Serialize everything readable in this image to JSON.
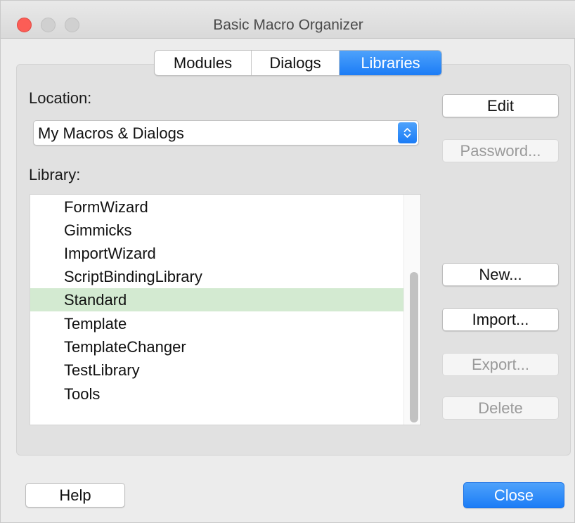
{
  "window": {
    "title": "Basic Macro Organizer"
  },
  "tabs": [
    {
      "label": "Modules"
    },
    {
      "label": "Dialogs"
    },
    {
      "label": "Libraries",
      "active": true
    }
  ],
  "location": {
    "label": "Location:",
    "selected": "My Macros & Dialogs"
  },
  "library": {
    "label": "Library:",
    "items": [
      "FormWizard",
      "Gimmicks",
      "ImportWizard",
      "ScriptBindingLibrary",
      "Standard",
      "Template",
      "TemplateChanger",
      "TestLibrary",
      "Tools"
    ],
    "selected": "Standard"
  },
  "buttons": {
    "edit": "Edit",
    "password": "Password...",
    "new": "New...",
    "import": "Import...",
    "export": "Export...",
    "delete": "Delete",
    "help": "Help",
    "close": "Close"
  },
  "colors": {
    "accent": "#1b7cf6",
    "selection": "#d3ead1",
    "close_traffic": "#fc5d56"
  }
}
